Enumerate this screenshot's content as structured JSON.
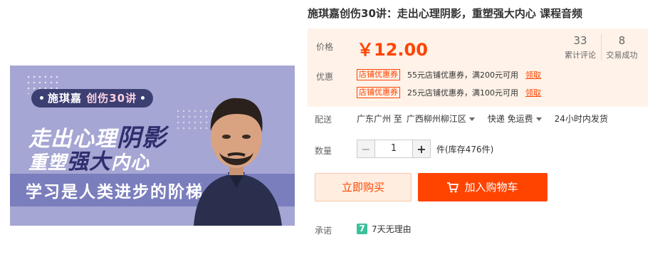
{
  "banner": {
    "pill": {
      "name": "施琪嘉",
      "accent": "创伤30讲"
    },
    "line1": {
      "plain": "走出心理",
      "dark": "阴影"
    },
    "line2": {
      "plain1": "重塑",
      "dark": "强大",
      "plain2": "内心"
    },
    "line3": "学习是人类进步的阶梯"
  },
  "product": {
    "title": "施琪嘉创伤30讲：走出心理阴影，重塑强大内心 课程音频"
  },
  "price_box": {
    "price_label": "价格",
    "price": "￥12.00",
    "stats": [
      {
        "num": "33",
        "label": "累计评论"
      },
      {
        "num": "8",
        "label": "交易成功"
      }
    ],
    "coupon_label": "优惠",
    "coupons": [
      {
        "tag": "店铺优惠券",
        "desc": "55元店铺优惠券，满200元可用",
        "action": "领取"
      },
      {
        "tag": "店铺优惠券",
        "desc": "25元店铺优惠券，满100元可用",
        "action": "领取"
      }
    ]
  },
  "shipping": {
    "label": "配送",
    "from": "广东广州 至",
    "to": "广西柳州柳江区",
    "method": "快递 免运费",
    "eta": "24小时内发货"
  },
  "quantity": {
    "label": "数量",
    "minus": "−",
    "value": "1",
    "plus": "+",
    "stock": "件(库存476件)"
  },
  "actions": {
    "buy_now": "立即购买",
    "add_to_cart": "加入购物车"
  },
  "promise": {
    "label": "承诺",
    "badge": "7",
    "text": "7天无理由"
  },
  "colors": {
    "accent": "#ff4400",
    "price_bg": "#fff2e8",
    "banner_bg": "#a6a6d4",
    "seven_badge": "#3cc19b"
  }
}
